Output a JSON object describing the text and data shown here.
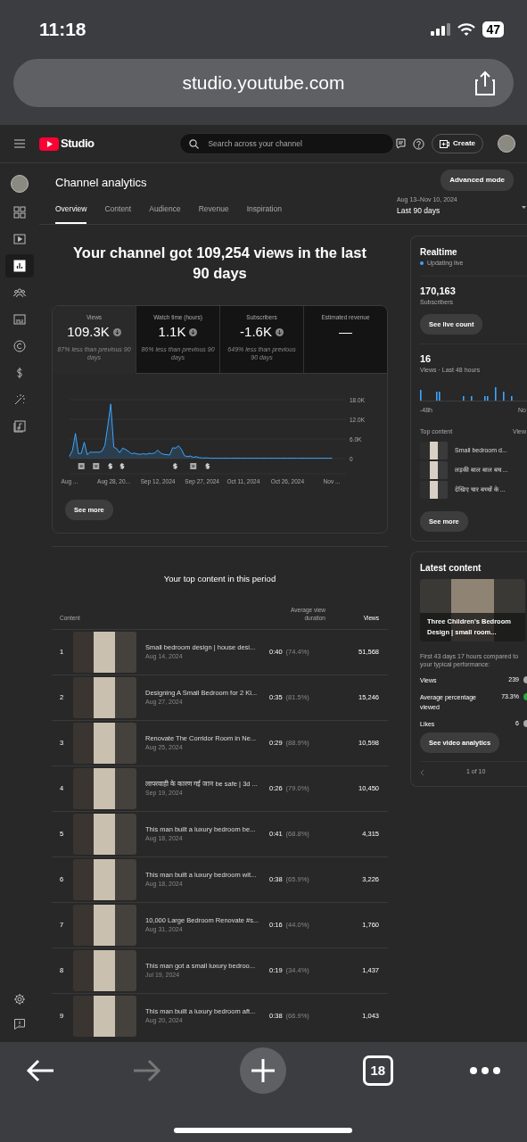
{
  "phone_status": {
    "time": "11:18",
    "battery": "47"
  },
  "browser": {
    "url": "studio.youtube.com",
    "tab_count": "18",
    "forward_disabled": true
  },
  "header": {
    "logo": "Studio",
    "search": {
      "placeholder": "Search across your channel"
    },
    "create": "Create"
  },
  "sidebar": {
    "items": [
      {
        "kind": "channel",
        "selected": false
      },
      {
        "kind": "dashboard",
        "selected": false
      },
      {
        "kind": "content",
        "selected": false
      },
      {
        "kind": "analytics",
        "selected": true
      },
      {
        "kind": "community",
        "selected": false
      },
      {
        "kind": "subtitles",
        "selected": false
      },
      {
        "kind": "copyright",
        "selected": false
      },
      {
        "kind": "earn",
        "selected": false
      },
      {
        "kind": "customization",
        "selected": false
      },
      {
        "kind": "audio",
        "selected": false
      }
    ],
    "bottom": [
      {
        "kind": "settings"
      },
      {
        "kind": "feedback"
      }
    ]
  },
  "page": {
    "title": "Channel analytics",
    "advanced_mode": "Advanced mode",
    "date_range": "Aug 13–Nov 10, 2024",
    "period": "Last 90 days",
    "tabs": [
      {
        "label": "Overview",
        "selected": true
      },
      {
        "label": "Content",
        "selected": false
      },
      {
        "label": "Audience",
        "selected": false
      },
      {
        "label": "Revenue",
        "selected": false
      },
      {
        "label": "Inspiration",
        "selected": false
      }
    ]
  },
  "headline": "Your channel got 109,254 views in the last 90 days",
  "metrics": [
    {
      "label": "Views",
      "value": "109.3K",
      "decreased": true,
      "note": "87% less than previous 90 days",
      "selected": true
    },
    {
      "label": "Watch time (hours)",
      "value": "1.1K",
      "decreased": true,
      "note": "86% less than previous 90 days",
      "selected": false
    },
    {
      "label": "Subscribers",
      "value": "-1.6K",
      "decreased": true,
      "note": "649% less than previous 90 days",
      "selected": false
    },
    {
      "label": "Estimated revenue",
      "value": "—",
      "selected": false
    }
  ],
  "chart_data": {
    "type": "area",
    "ylim": [
      0,
      18000
    ],
    "yticks": [
      {
        "value": 0,
        "label": "0"
      },
      {
        "value": 6000,
        "label": "6.0K"
      },
      {
        "value": 12000,
        "label": "12.0K"
      },
      {
        "value": 18000,
        "label": "18.0K"
      }
    ],
    "categories": [
      "Aug ...",
      null,
      null,
      null,
      null,
      null,
      null,
      null,
      null,
      null,
      null,
      null,
      null,
      null,
      null,
      "Aug 28, 20...",
      null,
      null,
      null,
      null,
      null,
      null,
      null,
      null,
      null,
      null,
      null,
      null,
      null,
      null,
      "Sep 12, 2024",
      null,
      null,
      null,
      null,
      null,
      null,
      null,
      null,
      null,
      null,
      null,
      null,
      null,
      null,
      "Sep 27, 2024",
      null,
      null,
      null,
      null,
      null,
      null,
      null,
      null,
      null,
      null,
      null,
      null,
      null,
      "Oct 11, 2024",
      null,
      null,
      null,
      null,
      null,
      null,
      null,
      null,
      null,
      null,
      null,
      null,
      null,
      null,
      "Oct 26, 2024",
      null,
      null,
      null,
      null,
      null,
      null,
      null,
      null,
      null,
      null,
      null,
      null,
      null,
      null,
      "Nov ..."
    ],
    "series": [
      {
        "color": "#3ea6ff",
        "values": [
          800,
          2500,
          7700,
          1500,
          1600,
          5000,
          1200,
          2000,
          1900,
          2000,
          1900,
          2300,
          4000,
          10000,
          16700,
          3500,
          3000,
          1800,
          3200,
          2800,
          2200,
          1500,
          1700,
          1400,
          1300,
          1500,
          1300,
          1600,
          1500,
          1800,
          2600,
          1600,
          1300,
          1200,
          1100,
          3300,
          3200,
          3900,
          2800,
          900,
          600,
          800,
          400,
          600,
          300,
          200,
          200,
          200,
          100,
          100,
          100,
          100,
          100,
          100,
          100,
          100,
          100,
          100,
          100,
          100,
          100,
          100,
          100,
          100,
          100,
          100,
          100,
          100,
          100,
          100,
          100,
          100,
          100,
          100,
          100,
          100,
          100,
          100,
          100,
          100,
          100,
          100,
          100,
          100,
          100,
          100,
          100,
          100,
          100,
          100
        ]
      }
    ]
  },
  "see_more": "See more",
  "top_content": {
    "title": "Your top content in this period",
    "columns": [
      "Content",
      "Average view duration",
      "Views"
    ],
    "rows": [
      {
        "rank": "1",
        "title": "Small bedroom design | house desi...",
        "date": "Aug 14, 2024",
        "duration": "0:40",
        "percent": "(74.4%)",
        "views": "51,568"
      },
      {
        "rank": "2",
        "title": "Designing A Small Bedroom for 2 Ki...",
        "date": "Aug 27, 2024",
        "duration": "0:35",
        "percent": "(81.5%)",
        "views": "15,246"
      },
      {
        "rank": "3",
        "title": "Renovate The Corridor Room in Ne...",
        "date": "Aug 25, 2024",
        "duration": "0:29",
        "percent": "(88.9%)",
        "views": "10,598"
      },
      {
        "rank": "4",
        "title": "लापरवाही के कारण गई जान be safe | 3d ...",
        "date": "Sep 19, 2024",
        "duration": "0:26",
        "percent": "(79.0%)",
        "views": "10,450"
      },
      {
        "rank": "5",
        "title": "This man built a luxury bedroom be...",
        "date": "Aug 18, 2024",
        "duration": "0:41",
        "percent": "(68.8%)",
        "views": "4,315"
      },
      {
        "rank": "6",
        "title": "This man built a luxury bedroom wit...",
        "date": "Aug 18, 2024",
        "duration": "0:38",
        "percent": "(65.9%)",
        "views": "3,226"
      },
      {
        "rank": "7",
        "title": "10,000 Large Bedroom Renovate #s...",
        "date": "Aug 31, 2024",
        "duration": "0:16",
        "percent": "(44.0%)",
        "views": "1,760"
      },
      {
        "rank": "8",
        "title": "This man got a small luxury bedroo...",
        "date": "Jul 19, 2024",
        "duration": "0:19",
        "percent": "(34.4%)",
        "views": "1,437"
      },
      {
        "rank": "9",
        "title": "This man built a luxury bedroom aft...",
        "date": "Aug 20, 2024",
        "duration": "0:38",
        "percent": "(66.9%)",
        "views": "1,043"
      }
    ]
  },
  "realtime": {
    "title": "Realtime",
    "status": "Updating live",
    "subscribers": "170,163",
    "subscribers_label": "Subscribers",
    "live_count_button": "See live count",
    "views": "16",
    "views_label": "Views · Last 48 hours",
    "axis_start": "-48h",
    "axis_end": "No",
    "top_content_label": "Top content",
    "views_column": "View",
    "items": [
      {
        "title": "Small bedroom d..."
      },
      {
        "title": "लड़की बाल बाल बच ..."
      },
      {
        "title": "देखिए चार बच्चों के ..."
      }
    ],
    "see_more": "See more"
  },
  "latest_content": {
    "title": "Latest content",
    "video_title": "Three Children's Bedroom Design | small room...",
    "comparison": "First 43 days 17 hours compared to your typical performance:",
    "stats": [
      {
        "label": "Views",
        "value": "239",
        "color": "#aaaaaa"
      },
      {
        "label": "Average percentage viewed",
        "value": "73.3%",
        "color": "#2ba640"
      },
      {
        "label": "Likes",
        "value": "6",
        "color": "#aaaaaa"
      }
    ],
    "button": "See video analytics",
    "pager": "1 of 10"
  }
}
